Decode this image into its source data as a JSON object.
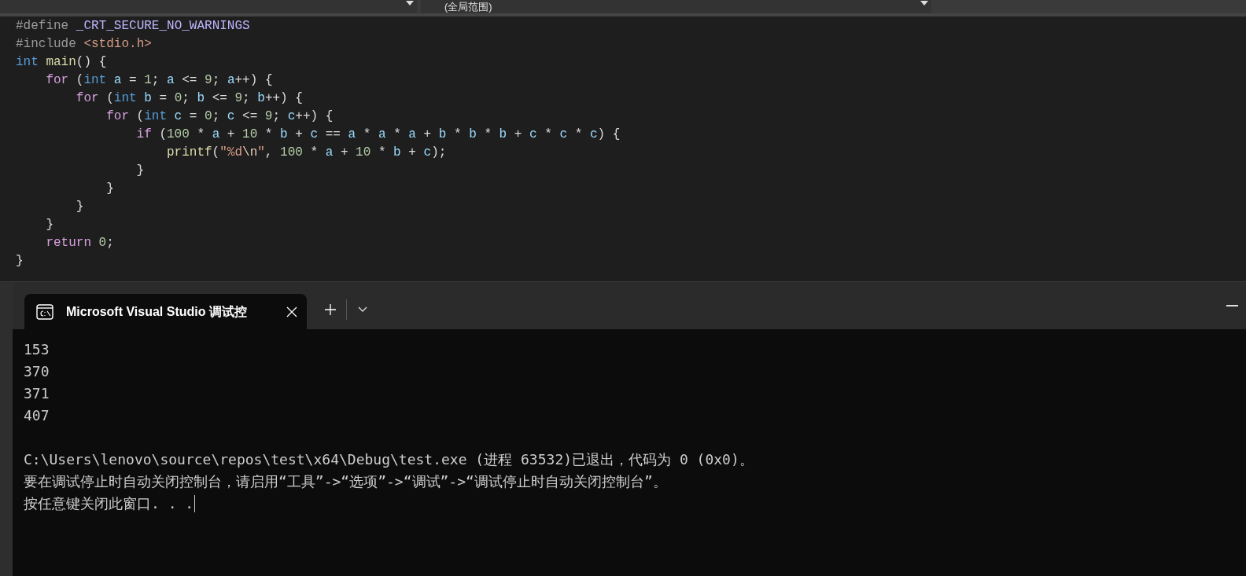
{
  "toolbar": {
    "scope_dropdown": {
      "value": "(全局范围)"
    }
  },
  "code": {
    "lines": [
      {
        "tokens": [
          {
            "kind": "preprocessor",
            "text": "#define"
          },
          {
            "kind": "macro",
            "text": " _CRT_SECURE_NO_WARNINGS"
          }
        ]
      },
      {
        "tokens": [
          {
            "kind": "preprocessor",
            "text": "#include"
          },
          {
            "kind": "string",
            "text": " <stdio.h>"
          }
        ]
      },
      {
        "tokens": [
          {
            "kind": "type",
            "text": "int"
          },
          {
            "kind": "function",
            "text": " main"
          },
          {
            "kind": "plain",
            "text": "() {"
          }
        ],
        "children": [
          {
            "tokens": [
              {
                "kind": "control",
                "text": "for"
              },
              {
                "kind": "plain",
                "text": " ("
              },
              {
                "kind": "type",
                "text": "int"
              },
              {
                "kind": "variable",
                "text": " a"
              },
              {
                "kind": "plain",
                "text": " = "
              },
              {
                "kind": "number",
                "text": "1"
              },
              {
                "kind": "plain",
                "text": "; "
              },
              {
                "kind": "variable",
                "text": "a"
              },
              {
                "kind": "plain",
                "text": " <= "
              },
              {
                "kind": "number",
                "text": "9"
              },
              {
                "kind": "plain",
                "text": "; "
              },
              {
                "kind": "variable",
                "text": "a"
              },
              {
                "kind": "plain",
                "text": "++) {"
              }
            ],
            "children": [
              {
                "tokens": [
                  {
                    "kind": "control",
                    "text": "for"
                  },
                  {
                    "kind": "plain",
                    "text": " ("
                  },
                  {
                    "kind": "type",
                    "text": "int"
                  },
                  {
                    "kind": "variable",
                    "text": " b"
                  },
                  {
                    "kind": "plain",
                    "text": " = "
                  },
                  {
                    "kind": "number",
                    "text": "0"
                  },
                  {
                    "kind": "plain",
                    "text": "; "
                  },
                  {
                    "kind": "variable",
                    "text": "b"
                  },
                  {
                    "kind": "plain",
                    "text": " <= "
                  },
                  {
                    "kind": "number",
                    "text": "9"
                  },
                  {
                    "kind": "plain",
                    "text": "; "
                  },
                  {
                    "kind": "variable",
                    "text": "b"
                  },
                  {
                    "kind": "plain",
                    "text": "++) {"
                  }
                ],
                "children": [
                  {
                    "tokens": [
                      {
                        "kind": "control",
                        "text": "for"
                      },
                      {
                        "kind": "plain",
                        "text": " ("
                      },
                      {
                        "kind": "type",
                        "text": "int"
                      },
                      {
                        "kind": "variable",
                        "text": " c"
                      },
                      {
                        "kind": "plain",
                        "text": " = "
                      },
                      {
                        "kind": "number",
                        "text": "0"
                      },
                      {
                        "kind": "plain",
                        "text": "; "
                      },
                      {
                        "kind": "variable",
                        "text": "c"
                      },
                      {
                        "kind": "plain",
                        "text": " <= "
                      },
                      {
                        "kind": "number",
                        "text": "9"
                      },
                      {
                        "kind": "plain",
                        "text": "; "
                      },
                      {
                        "kind": "variable",
                        "text": "c"
                      },
                      {
                        "kind": "plain",
                        "text": "++) {"
                      }
                    ],
                    "children": [
                      {
                        "tokens": [
                          {
                            "kind": "control",
                            "text": "if"
                          },
                          {
                            "kind": "plain",
                            "text": " ("
                          },
                          {
                            "kind": "number",
                            "text": "100"
                          },
                          {
                            "kind": "plain",
                            "text": " * "
                          },
                          {
                            "kind": "variable",
                            "text": "a"
                          },
                          {
                            "kind": "plain",
                            "text": " + "
                          },
                          {
                            "kind": "number",
                            "text": "10"
                          },
                          {
                            "kind": "plain",
                            "text": " * "
                          },
                          {
                            "kind": "variable",
                            "text": "b"
                          },
                          {
                            "kind": "plain",
                            "text": " + "
                          },
                          {
                            "kind": "variable",
                            "text": "c"
                          },
                          {
                            "kind": "plain",
                            "text": " == "
                          },
                          {
                            "kind": "variable",
                            "text": "a"
                          },
                          {
                            "kind": "plain",
                            "text": " * "
                          },
                          {
                            "kind": "variable",
                            "text": "a"
                          },
                          {
                            "kind": "plain",
                            "text": " * "
                          },
                          {
                            "kind": "variable",
                            "text": "a"
                          },
                          {
                            "kind": "plain",
                            "text": " + "
                          },
                          {
                            "kind": "variable",
                            "text": "b"
                          },
                          {
                            "kind": "plain",
                            "text": " * "
                          },
                          {
                            "kind": "variable",
                            "text": "b"
                          },
                          {
                            "kind": "plain",
                            "text": " * "
                          },
                          {
                            "kind": "variable",
                            "text": "b"
                          },
                          {
                            "kind": "plain",
                            "text": " + "
                          },
                          {
                            "kind": "variable",
                            "text": "c"
                          },
                          {
                            "kind": "plain",
                            "text": " * "
                          },
                          {
                            "kind": "variable",
                            "text": "c"
                          },
                          {
                            "kind": "plain",
                            "text": " * "
                          },
                          {
                            "kind": "variable",
                            "text": "c"
                          },
                          {
                            "kind": "plain",
                            "text": ") {"
                          }
                        ],
                        "children": [
                          {
                            "tokens": [
                              {
                                "kind": "function",
                                "text": "printf"
                              },
                              {
                                "kind": "plain",
                                "text": "("
                              },
                              {
                                "kind": "string",
                                "text": "\"%d"
                              },
                              {
                                "kind": "escape",
                                "text": "\\n"
                              },
                              {
                                "kind": "string",
                                "text": "\""
                              },
                              {
                                "kind": "plain",
                                "text": ", "
                              },
                              {
                                "kind": "number",
                                "text": "100"
                              },
                              {
                                "kind": "plain",
                                "text": " * "
                              },
                              {
                                "kind": "variable",
                                "text": "a"
                              },
                              {
                                "kind": "plain",
                                "text": " + "
                              },
                              {
                                "kind": "number",
                                "text": "10"
                              },
                              {
                                "kind": "plain",
                                "text": " * "
                              },
                              {
                                "kind": "variable",
                                "text": "b"
                              },
                              {
                                "kind": "plain",
                                "text": " + "
                              },
                              {
                                "kind": "variable",
                                "text": "c"
                              },
                              {
                                "kind": "plain",
                                "text": ");"
                              }
                            ]
                          }
                        ]
                      },
                      {
                        "tokens": [
                          {
                            "kind": "plain",
                            "text": "}"
                          }
                        ]
                      }
                    ]
                  },
                  {
                    "tokens": [
                      {
                        "kind": "plain",
                        "text": "}"
                      }
                    ]
                  }
                ]
              },
              {
                "tokens": [
                  {
                    "kind": "plain",
                    "text": "}"
                  }
                ]
              }
            ]
          },
          {
            "tokens": [
              {
                "kind": "plain",
                "text": "}"
              }
            ]
          },
          {
            "tokens": [
              {
                "kind": "control",
                "text": "return"
              },
              {
                "kind": "number",
                "text": " 0"
              },
              {
                "kind": "plain",
                "text": ";"
              }
            ]
          }
        ]
      },
      {
        "tokens": [
          {
            "kind": "plain",
            "text": "}"
          }
        ]
      }
    ]
  },
  "terminal": {
    "tabs": [
      {
        "title": "Microsoft Visual Studio 调试控",
        "selected": true
      }
    ],
    "results": [
      "153",
      "370",
      "371",
      "407"
    ],
    "messages": [
      "C:\\Users\\lenovo\\source\\repos\\test\\x64\\Debug\\test.exe (进程 63532)已退出，代码为 0 (0x0)。",
      "要在调试停止时自动关闭控制台，请启用“工具”->“选项”->“调试”->“调试停止时自动关闭控制台”。",
      "按任意键关闭此窗口. . ."
    ]
  }
}
